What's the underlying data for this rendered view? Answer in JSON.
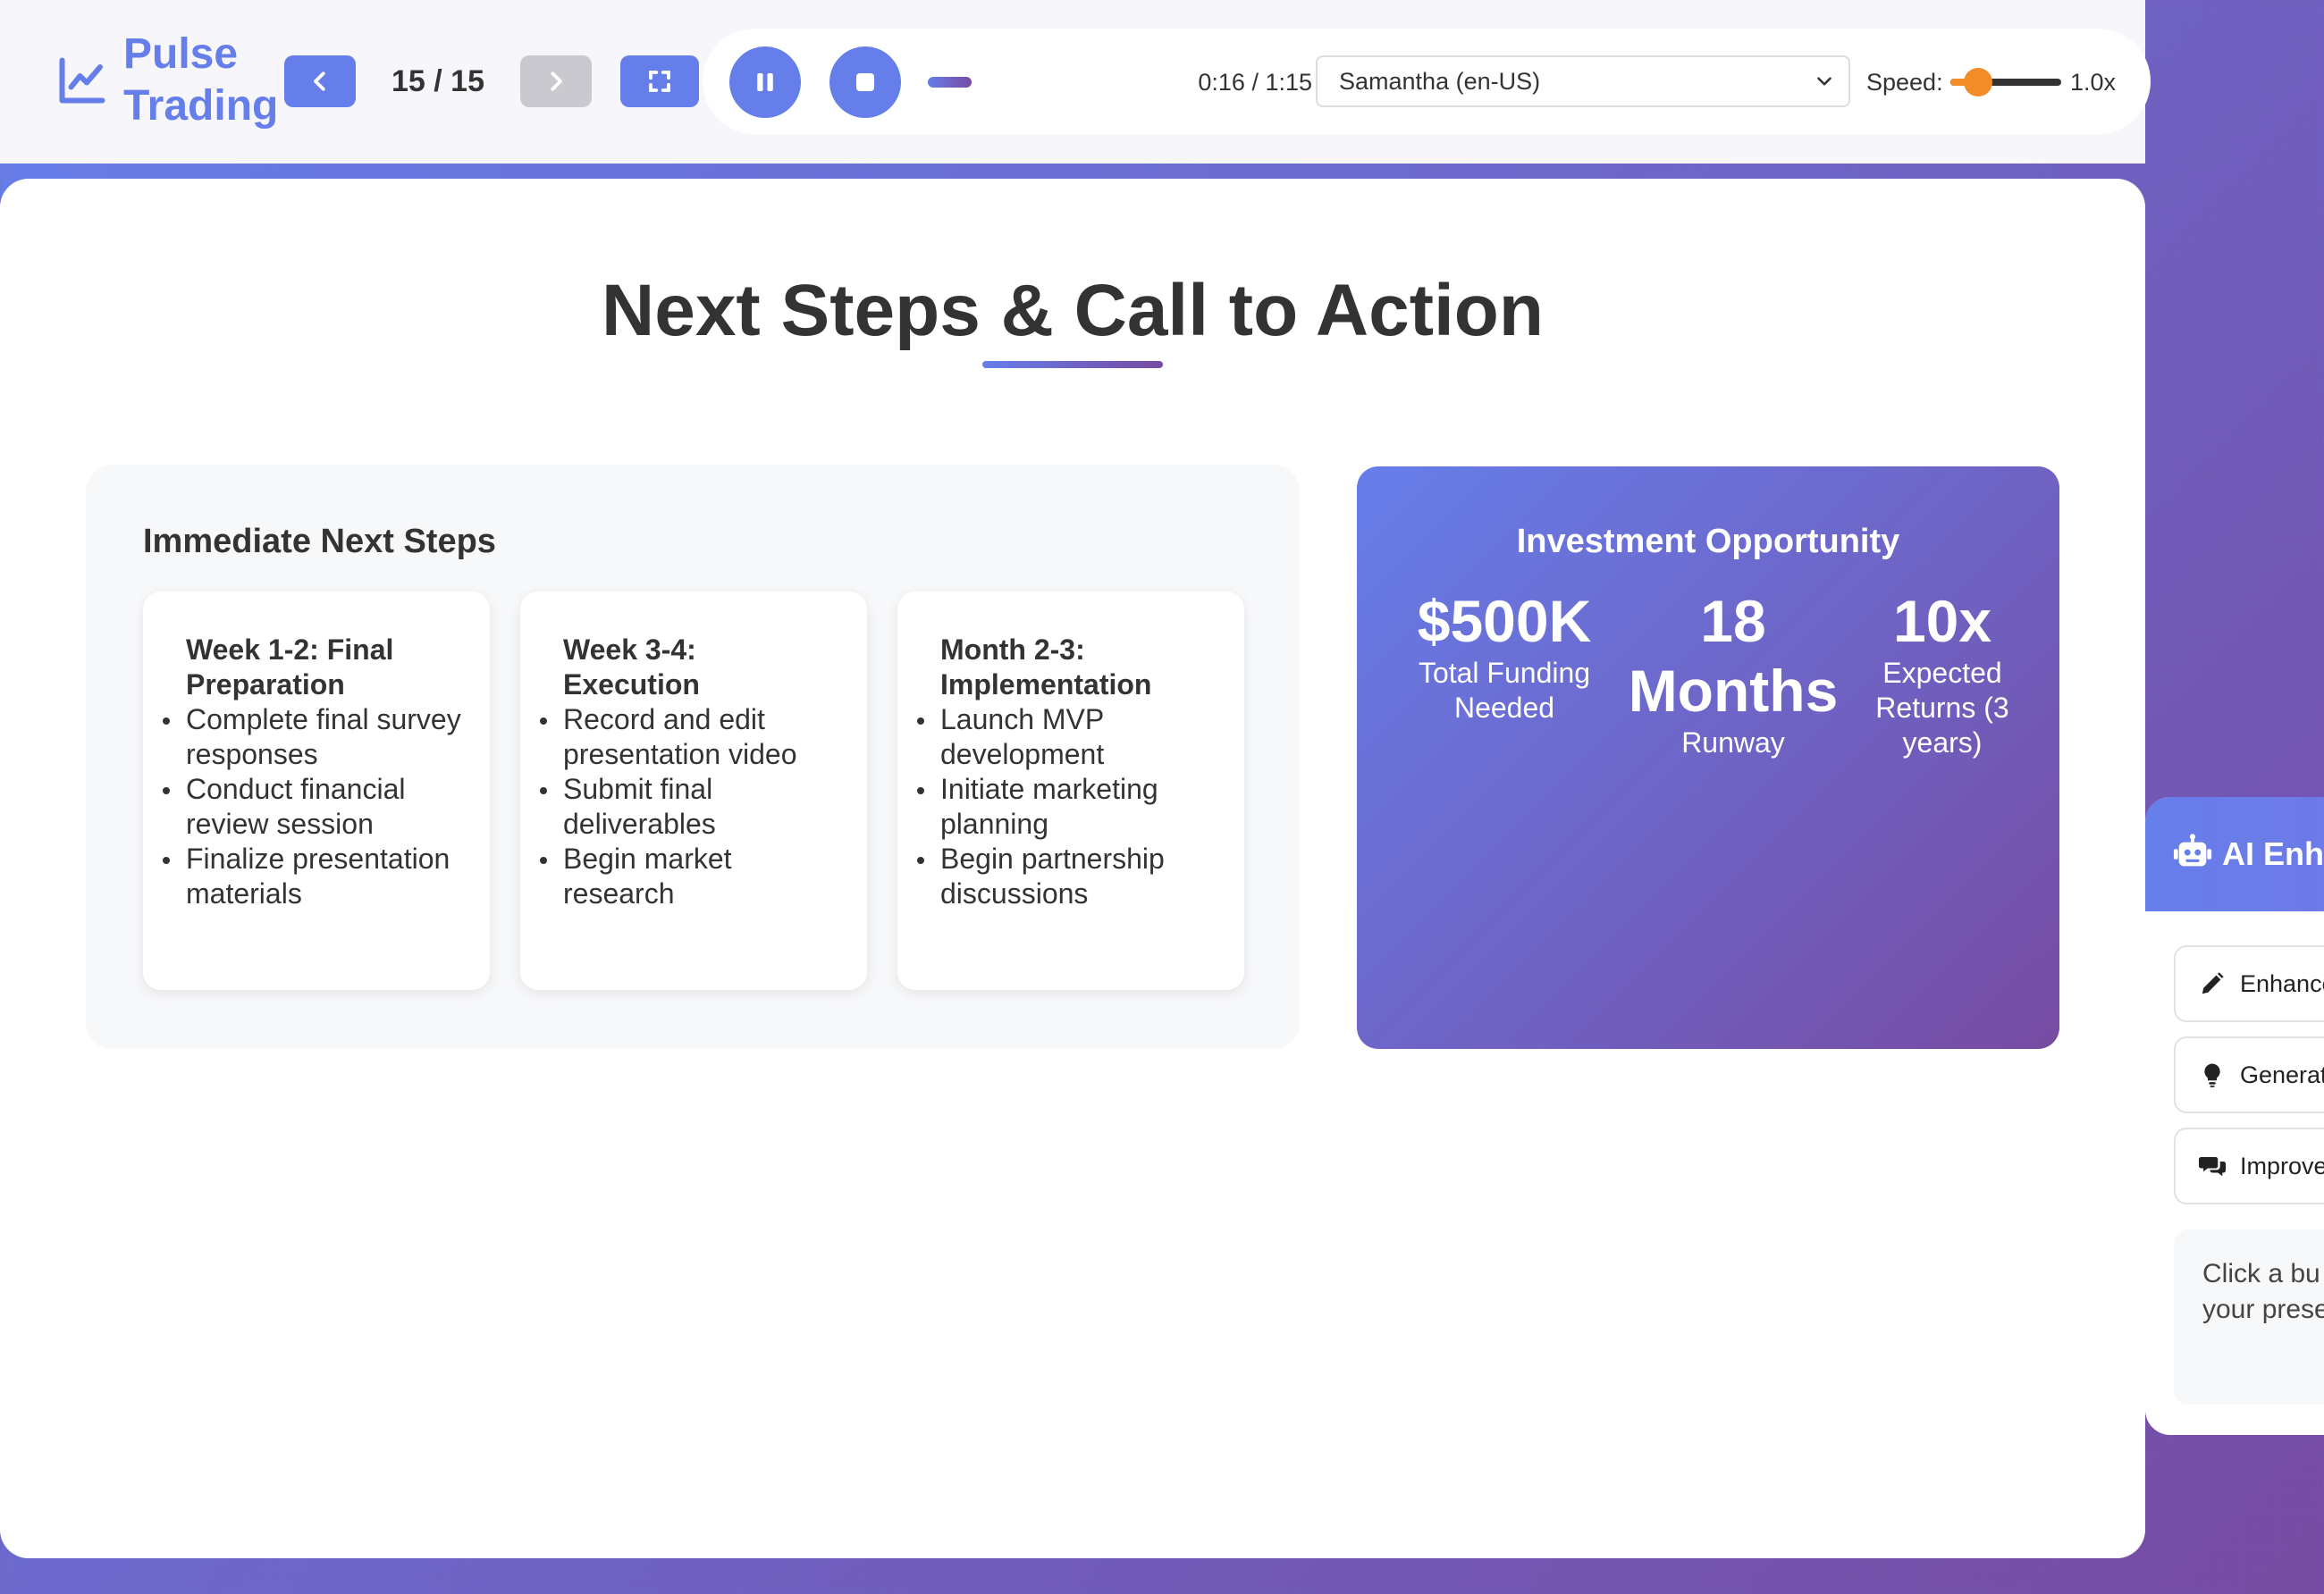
{
  "header": {
    "logo_text": "Pulse Trading",
    "slide_counter": "15 / 15",
    "player": {
      "time": "0:16 / 1:15",
      "progress": 0.19,
      "voice": "Samantha (en-US)",
      "speed_label": "Speed:",
      "speed_value": "1.0x",
      "speed_level": 0.25
    }
  },
  "slide": {
    "title": "Next Steps & Call to Action",
    "steps": {
      "heading": "Immediate Next Steps",
      "cards": [
        {
          "title": "Week 1-2: Final Preparation",
          "items": [
            "Complete final survey responses",
            "Conduct financial review session",
            "Finalize presentation materials"
          ]
        },
        {
          "title": "Week 3-4: Execution",
          "items": [
            "Record and edit presentation video",
            "Submit final deliverables",
            "Begin market research"
          ]
        },
        {
          "title": "Month 2-3: Implementation",
          "items": [
            "Launch MVP development",
            "Initiate marketing planning",
            "Begin partnership discussions"
          ]
        }
      ]
    },
    "investment": {
      "title": "Investment Opportunity",
      "metrics": [
        {
          "value": "$500K",
          "label": "Total Funding Needed"
        },
        {
          "value": "18 Months",
          "label": "Runway"
        },
        {
          "value": "10x",
          "label": "Expected Returns (3 years)"
        }
      ]
    }
  },
  "ai_panel": {
    "title": "AI Enh",
    "buttons": [
      {
        "label": "Enhance",
        "icon": "pencil-icon"
      },
      {
        "label": "Generate",
        "icon": "lightbulb-icon"
      },
      {
        "label": "Improve",
        "icon": "comments-icon"
      }
    ],
    "message_line1": "Click a bu",
    "message_line2": "your prese"
  },
  "colors": {
    "accent": "#667eea",
    "accent_dark": "#764ba2",
    "slider": "#f28c28"
  }
}
